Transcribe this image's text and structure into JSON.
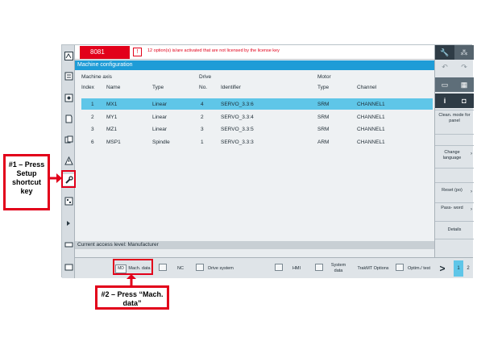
{
  "alarm": {
    "number": "8081",
    "indicator": "!",
    "message": "12 option(s) is/are activated that are not licensed by the license key"
  },
  "title": "Machine configuration",
  "table": {
    "group_headers": {
      "machine_axis": "Machine axis",
      "drive": "Drive",
      "motor": "Motor"
    },
    "columns": {
      "index": "Index",
      "name": "Name",
      "type": "Type",
      "drive_no": "No.",
      "identifier": "Identifier",
      "motor_type": "Type",
      "channel": "Channel"
    },
    "rows": [
      {
        "index": "1",
        "name": "MX1",
        "type": "Linear",
        "drive_no": "4",
        "identifier": "SERVO_3.3:6",
        "motor_type": "SRM",
        "channel": "CHANNEL1"
      },
      {
        "index": "2",
        "name": "MY1",
        "type": "Linear",
        "drive_no": "2",
        "identifier": "SERVO_3.3:4",
        "motor_type": "SRM",
        "channel": "CHANNEL1"
      },
      {
        "index": "3",
        "name": "MZ1",
        "type": "Linear",
        "drive_no": "3",
        "identifier": "SERVO_3.3:5",
        "motor_type": "SRM",
        "channel": "CHANNEL1"
      },
      {
        "index": "6",
        "name": "MSP1",
        "type": "Spindle",
        "drive_no": "1",
        "identifier": "SERVO_3.3:3",
        "motor_type": "ARM",
        "channel": "CHANNEL1"
      }
    ]
  },
  "access_level": "Current access level: Manufacturer",
  "right_softkeys": {
    "clean_mode": "Clean. mode for panel",
    "change_language": "Change language",
    "reset": "Reset (po)",
    "password": "Pass- word",
    "details": "Details"
  },
  "bottom_softkeys": {
    "mach_data_icon": "MD",
    "mach_data": "Mach. data",
    "nc": "NC",
    "drive_system": "Drive system",
    "hmi": "HMI",
    "system_data": "System data",
    "trakmt_options": "TrakMT Options",
    "optim_test": "Optim./ test",
    "more": ">",
    "page1": "1",
    "page2": "2"
  },
  "annotations": {
    "step1": "#1 – Press Setup shortcut key",
    "step2": "#2 – Press “Mach. data”"
  },
  "colors": {
    "accent": "#1e9cd7",
    "selected_row": "#5fc6e8",
    "alarm": "#e2001a",
    "callout_border": "#e2001a"
  }
}
